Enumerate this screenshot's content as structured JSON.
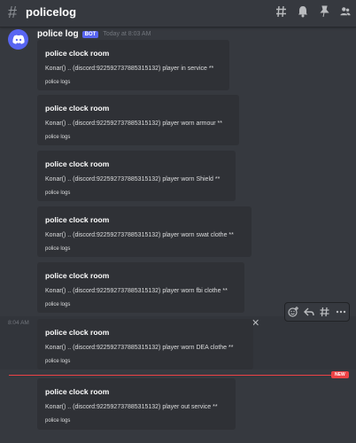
{
  "channel": {
    "name": "policelog"
  },
  "message": {
    "author": "police log",
    "bot_tag": "BOT",
    "timestamp": "Today at 8:03 AM",
    "avatar_color": "#5865f2"
  },
  "embeds": [
    {
      "title": "police clock room",
      "description": "Konar() .. (discord:922592737885315132) player in service **",
      "footer": "police logs"
    },
    {
      "title": "police clock room",
      "description": "Konar() .. (discord:922592737885315132) player worn armour **",
      "footer": "police logs"
    },
    {
      "title": "police clock room",
      "description": "Konar() .. (discord:922592737885315132) player worn Shield **",
      "footer": "police logs"
    },
    {
      "title": "police clock room",
      "description": "Konar() .. (discord:922592737885315132) player worn swat clothe **",
      "footer": "police logs"
    },
    {
      "title": "police clock room",
      "description": "Konar() .. (discord:922592737885315132) player worn fbi clothe **",
      "footer": "police logs"
    },
    {
      "title": "police clock room",
      "description": "Konar() .. (discord:922592737885315132) player worn DEA clothe **",
      "footer": "police logs"
    },
    {
      "title": "police clock room",
      "description": "Konar() .. (discord:922592737885315132) player out service **",
      "footer": "police logs"
    }
  ],
  "hover_time": "8:04 AM",
  "new_divider": {
    "label": "NEW",
    "color": "#ed4245"
  },
  "colors": {
    "background": "#36393f",
    "embed_bg": "#2f3136",
    "accent": "#5865f2"
  },
  "icons": {
    "header": [
      "threads-icon",
      "bell-icon",
      "pin-icon",
      "members-icon"
    ],
    "toolbar": [
      "add-reaction-icon",
      "reply-icon",
      "thread-icon",
      "more-icon"
    ]
  }
}
